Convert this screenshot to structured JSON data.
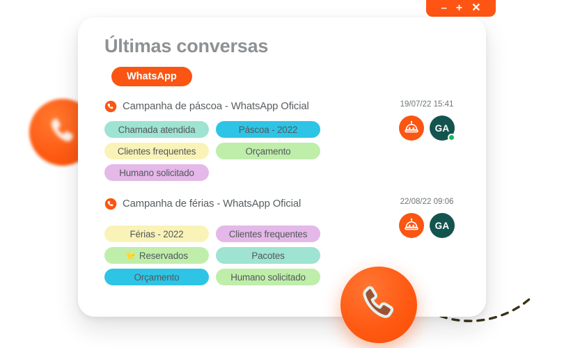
{
  "window_controls": {
    "minimize_label": "–",
    "maximize_label": "+",
    "close_label": "✕",
    "bar_color": "#ff5514"
  },
  "card": {
    "title": "Últimas conversas",
    "channel_badge": {
      "label": "WhatsApp",
      "color": "#fa5512"
    }
  },
  "conversations": [
    {
      "icon": "whatsapp-phone-icon",
      "title": "Campanha de páscoa - WhatsApp Oficial",
      "timestamp": "19/07/22 15:41",
      "avatars": [
        {
          "type": "bot",
          "icon": "bot-avatar-icon",
          "color": "#fa5512"
        },
        {
          "type": "initials",
          "label": "GA",
          "color": "#14544f",
          "online": true,
          "online_color": "#17b95b"
        }
      ],
      "tags": [
        [
          {
            "label": "Chamada atendida",
            "color": "#9fe3d2"
          },
          {
            "label": "Páscoa - 2022",
            "color": "#2ec4e6"
          }
        ],
        [
          {
            "label": "Clientes frequentes",
            "color": "#faf3b8"
          },
          {
            "label": "Orçamento",
            "color": "#bfeeaa"
          }
        ],
        [
          {
            "label": "Humano solicitado",
            "color": "#e4b8e8"
          }
        ]
      ]
    },
    {
      "icon": "whatsapp-phone-icon",
      "title": "Campanha de férias - WhatsApp Oficial",
      "timestamp": "22/08/22 09:06",
      "avatars": [
        {
          "type": "bot",
          "icon": "bot-avatar-icon",
          "color": "#fa5512"
        },
        {
          "type": "initials",
          "label": "GA",
          "color": "#14544f",
          "online": false
        }
      ],
      "tags": [
        [
          {
            "label": "Férias - 2022",
            "color": "#faf3b8"
          },
          {
            "label": "Clientes frequentes",
            "color": "#e4b8e8"
          }
        ],
        [
          {
            "label": "Reservados",
            "color": "#bfeeaa",
            "star": "⭐"
          },
          {
            "label": "Pacotes",
            "color": "#9fe3d2"
          }
        ],
        [
          {
            "label": "Orçamento",
            "color": "#2ec4e6"
          },
          {
            "label": "Humano solicitado",
            "color": "#bfeeaa"
          }
        ]
      ]
    }
  ],
  "decorations": {
    "phone_bubble_left": "phone-handset-icon",
    "phone_bubble_big": "phone-handset-icon",
    "balloon": "dashed-balloon-outline",
    "curve": "dashed-curve-line"
  }
}
